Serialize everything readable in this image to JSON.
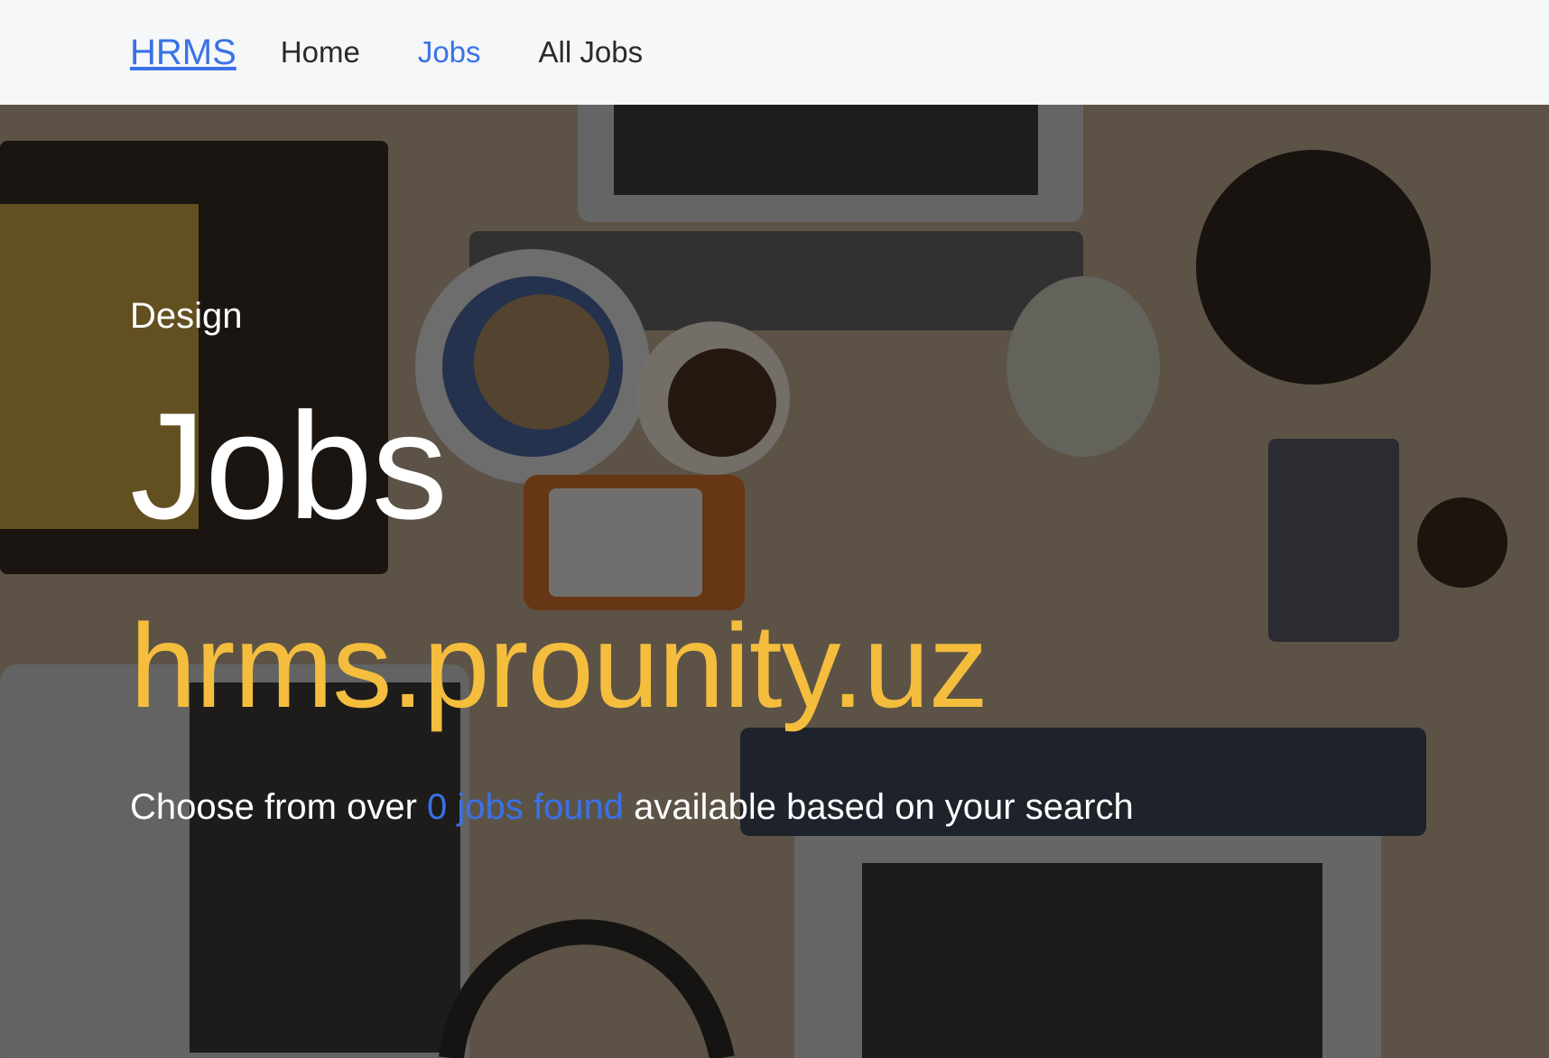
{
  "navbar": {
    "brand": "HRMS",
    "links": [
      {
        "label": "Home"
      },
      {
        "label": "Jobs",
        "active": true
      },
      {
        "label": "All Jobs"
      }
    ]
  },
  "hero": {
    "eyebrow": "Design",
    "headline": "Jobs",
    "domain": "hrms.prounity.uz",
    "subtext_before": "Choose from over ",
    "subtext_highlight": "0 jobs found",
    "subtext_after": " available based on your search",
    "background_description_icon": "desk-with-laptops-photo"
  },
  "colors": {
    "accent": "#3a72e6",
    "domain": "#f4bd3d",
    "navbar_bg": "#f6f7f9"
  }
}
